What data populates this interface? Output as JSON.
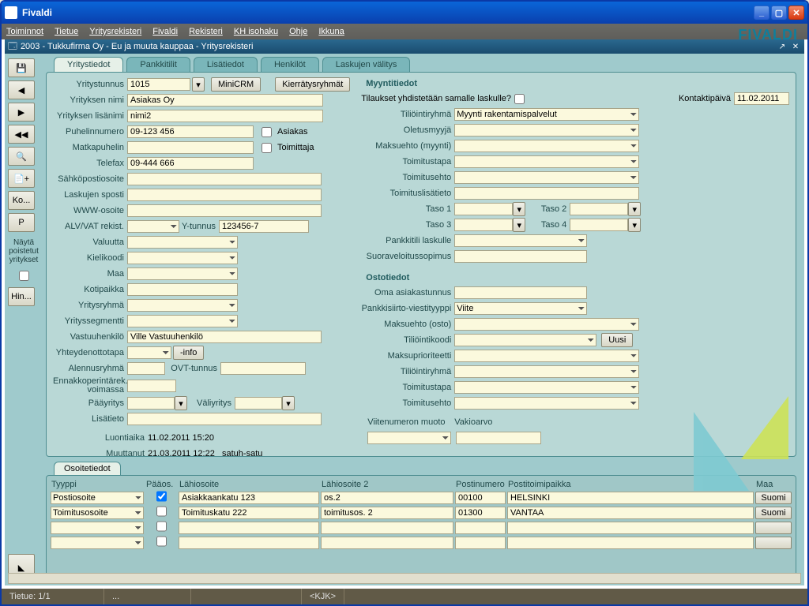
{
  "app_title": "Fivaldi",
  "brand": "FIVALDI",
  "menubar": [
    "Toiminnot",
    "Tietue",
    "Yritysrekisteri",
    "Fivaldi",
    "Rekisteri",
    "KH isohaku",
    "Ohje",
    "Ikkuna"
  ],
  "internal_title": "2003 - Tukkufirma Oy - Eu ja muuta kauppaa - Yritysrekisteri",
  "tabs": [
    "Yritystiedot",
    "Pankkitilit",
    "Lisätiedot",
    "Henkilöt",
    "Laskujen välitys"
  ],
  "toolbar_text": {
    "ko": "Ko...",
    "p": "P",
    "hin": "Hin..."
  },
  "side_note": "Näytä poistetut yritykset",
  "buttons": {
    "minicrm": "MiniCRM",
    "kierratys": "Kierrätysryhmät",
    "uusi": "Uusi",
    "info": "-info"
  },
  "left_labels": {
    "yritystunnus": "Yritystunnus",
    "yrityksen_nimi": "Yrityksen nimi",
    "yrityksen_lisanimi": "Yrityksen lisänimi",
    "puhelinnumero": "Puhelinnumero",
    "matkapuhelin": "Matkapuhelin",
    "telefax": "Telefax",
    "sahkoposti": "Sähköpostiosoite",
    "laskujen_sposti": "Laskujen sposti",
    "www": "WWW-osoite",
    "alv": "ALV/VAT rekist.",
    "ytunnus": "Y-tunnus",
    "valuutta": "Valuutta",
    "kielikoodi": "Kielikoodi",
    "maa": "Maa",
    "kotipaikka": "Kotipaikka",
    "yritysryhma": "Yritysryhmä",
    "yrityssegmentti": "Yrityssegmentti",
    "vastuuhenkilo": "Vastuuhenkilö",
    "yhteydenotto": "Yhteydenottotapa",
    "alennusryhma": "Alennusryhmä",
    "ovt": "OVT-tunnus",
    "ennakko": "Ennakkoperintärek. voimassa",
    "paayritys": "Pääyritys",
    "valiyritys": "Väliyritys",
    "lisatieto": "Lisätieto",
    "asiakas": "Asiakas",
    "toimittaja": "Toimittaja"
  },
  "left_values": {
    "yritystunnus": "1015",
    "yrityksen_nimi": "Asiakas Oy",
    "yrityksen_lisanimi": "nimi2",
    "puhelinnumero": "09-123 456",
    "telefax": "09-444 666",
    "ytunnus": "123456-7",
    "vastuuhenkilo": "Ville Vastuuhenkilö"
  },
  "audit": {
    "luontiaika_lbl": "Luontiaika",
    "luontiaika": "11.02.2011 15:20",
    "muuttanut_lbl": "Muuttanut",
    "muuttanut": "21.03.2011 12:22",
    "muuttaja": "satuh-satu"
  },
  "right": {
    "section_myynti": "Myyntitiedot",
    "tilaukset_lbl": "Tilaukset yhdistetään samalle laskulle?",
    "kontaktipaiva_lbl": "Kontaktipäivä",
    "kontaktipaiva": "11.02.2011",
    "tiliointiryhma_lbl": "Tiliöintiryhmä",
    "tiliointiryhma": "Myynti rakentamispalvelut",
    "oletusmyyja": "Oletusmyyjä",
    "maksuehto_myynti": "Maksuehto (myynti)",
    "toimitustapa": "Toimitustapa",
    "toimitusehto": "Toimitusehto",
    "toimituslisatieto": "Toimituslisätieto",
    "taso1": "Taso 1",
    "taso2": "Taso 2",
    "taso3": "Taso 3",
    "taso4": "Taso 4",
    "pankkitili": "Pankkitili laskulle",
    "suoraveloitus": "Suoraveloitussopimus",
    "section_osto": "Ostotiedot",
    "oma_asiakastunnus": "Oma asiakastunnus",
    "pankkisiirto_lbl": "Pankkisiirto-viestityyppi",
    "pankkisiirto": "Viite",
    "maksuehto_osto": "Maksuehto (osto)",
    "tiliointikoodi": "Tiliöintikoodi",
    "maksuprioriteetti": "Maksuprioriteetti",
    "tiliointiryhma2": "Tiliöintiryhmä",
    "toimitustapa2": "Toimitustapa",
    "toimitusehto2": "Toimitusehto",
    "viitenumeron": "Viitenumeron muoto",
    "vakioarvo": "Vakioarvo"
  },
  "addr": {
    "tab": "Osoitetiedot",
    "headers": [
      "Tyyppi",
      "Pääos.",
      "Lähiosoite",
      "Lähiosoite 2",
      "Postinumero",
      "Postitoimipaikka",
      "Maa"
    ],
    "rows": [
      {
        "tyyppi": "Postiosoite",
        "paaos": true,
        "lah1": "Asiakkaankatu 123",
        "lah2": "os.2",
        "pnro": "00100",
        "ptp": "HELSINKI",
        "maa": "Suomi"
      },
      {
        "tyyppi": "Toimitusosoite",
        "paaos": false,
        "lah1": "Toimituskatu 222",
        "lah2": "toimitusos. 2",
        "pnro": "01300",
        "ptp": "VANTAA",
        "maa": "Suomi"
      }
    ]
  },
  "status": {
    "tietue": "Tietue: 1/1",
    "dots": "...",
    "kjk": "<KJK>"
  }
}
